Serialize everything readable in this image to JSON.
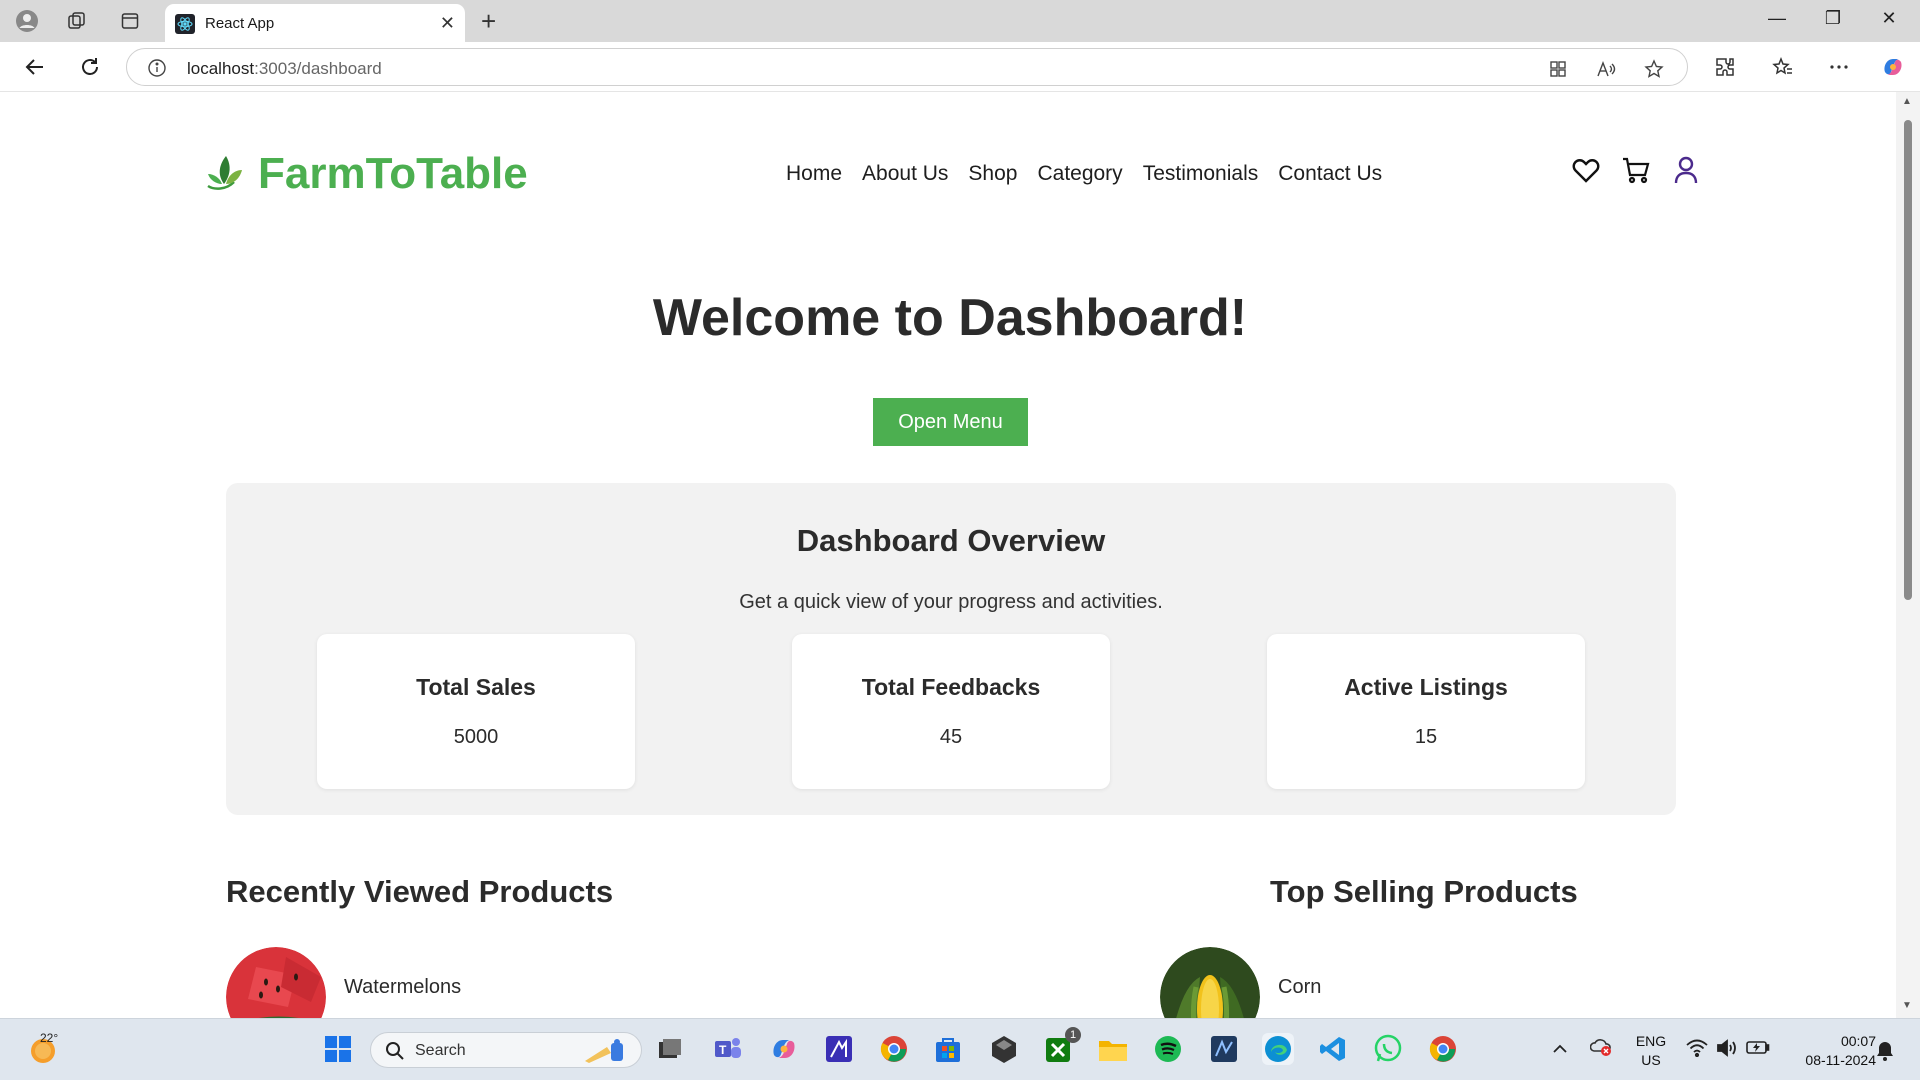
{
  "browser": {
    "tab_title": "React App",
    "url_host": "localhost",
    "url_rest": ":3003/dashboard"
  },
  "header": {
    "logo_text": "FarmToTable",
    "nav": [
      "Home",
      "About Us",
      "Shop",
      "Category",
      "Testimonials",
      "Contact Us"
    ]
  },
  "main": {
    "welcome": "Welcome to Dashboard!",
    "open_menu": "Open Menu",
    "overview": {
      "title": "Dashboard Overview",
      "subtitle": "Get a quick view of your progress and activities.",
      "cards": [
        {
          "title": "Total Sales",
          "value": "5000"
        },
        {
          "title": "Total Feedbacks",
          "value": "45"
        },
        {
          "title": "Active Listings",
          "value": "15"
        }
      ]
    },
    "recent": {
      "title": "Recently Viewed Products",
      "items": [
        {
          "name": "Watermelons"
        }
      ]
    },
    "top": {
      "title": "Top Selling Products",
      "items": [
        {
          "name": "Corn"
        }
      ]
    }
  },
  "taskbar": {
    "weather_temp": "22°",
    "search_placeholder": "Search",
    "xbox_badge": "1",
    "lang": "ENG",
    "region": "US",
    "time": "00:07",
    "date": "08-11-2024"
  },
  "colors": {
    "brand_green": "#4caf50",
    "text_dark": "#2b2b2b",
    "overview_bg": "#f2f2f2"
  }
}
